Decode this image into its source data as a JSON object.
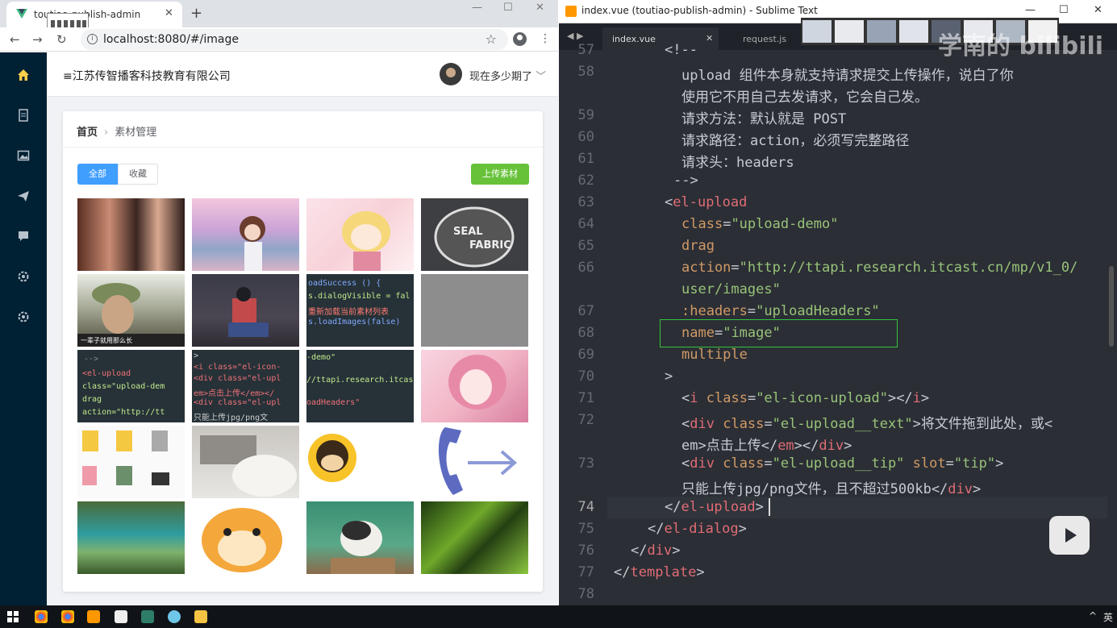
{
  "browser": {
    "tab_title": "toutiao-publish-admin",
    "url": "localhost:8080/#/image",
    "new_tab": "+",
    "tab_close": "✕"
  },
  "app": {
    "company": "≡江苏传智播客科技教育有限公司",
    "user_name": "现在多少期了",
    "breadcrumb": {
      "home": "首页",
      "current": "素材管理"
    },
    "filters": [
      "全部",
      "收藏"
    ],
    "upload_label": "上传素材",
    "code_thumbs": {
      "t7": [
        "oadSuccess () {",
        "s.dialogVisible = fal",
        "重新加载当前素材列表",
        "s.loadImages(false)"
      ],
      "t9": [
        "-->",
        "<el-upload",
        "  class=\"upload-dem",
        "  drag",
        "  action=\"http://tt"
      ],
      "t10": [
        ">",
        "  <i class=\"el-icon-",
        "  <div class=\"el-upl",
        "  em>点击上传</em></",
        "  <div class=\"el-upl",
        "  只能上传jpg/png文"
      ],
      "t11": [
        "-demo\"",
        "//ttapi.research.itcast",
        "oadHeaders\""
      ]
    },
    "meme_caption": "一辈子就用那么长"
  },
  "sublime": {
    "title": "index.vue (toutiao-publish-admin) - Sublime Text",
    "tabs": [
      "index.vue",
      "request.js"
    ],
    "watermark": "学南的 bilibili",
    "line_numbers": [
      "57",
      "58",
      "",
      "59",
      "60",
      "61",
      "62",
      "63",
      "64",
      "65",
      "66",
      "",
      "67",
      "68",
      "69",
      "70",
      "71",
      "72",
      "",
      "73",
      "",
      "74",
      "75",
      "76",
      "77",
      "78"
    ],
    "code": {
      "l57": "<!--",
      "l58a": "upload 组件本身就支持请求提交上传操作，说白了你",
      "l58b": "使用它不用自己去发请求，它会自己发。",
      "l59": "请求方法：默认就是 POST",
      "l60": "请求路径：action，必须写完整路径",
      "l61": "请求头：headers",
      "l62": "-->",
      "l63": "el-upload",
      "l64_attr": "class",
      "l64_val": "\"upload-demo\"",
      "l65": "drag",
      "l66_attr": "action",
      "l66_val": "\"http://ttapi.research.itcast.cn/mp/v1_0/",
      "l66_val2": "user/images\"",
      "l67_attr": ":headers",
      "l67_val": "\"uploadHeaders\"",
      "l68_attr": "name",
      "l68_val": "\"image\"",
      "l69": "multiple",
      "l70": ">",
      "l71_tag": "i",
      "l71_attr": "class",
      "l71_val": "\"el-icon-upload\"",
      "l71_close": "i",
      "l72_tag": "div",
      "l72_attr": "class",
      "l72_val": "\"el-upload__text\"",
      "l72_text": "将文件拖到此处，或<",
      "l72b_text1": "em>点击上传</",
      "l72b_tag": "em",
      "l72b_close": "div",
      "l73_tag": "div",
      "l73_attr1": "class",
      "l73_val1": "\"el-upload__tip\"",
      "l73_attr2": "slot",
      "l73_val2": "\"tip\"",
      "l73b_text": "只能上传jpg/png文件，且不超过500kb</",
      "l73b_close": "div",
      "l74": "el-upload",
      "l75": "el-dialog",
      "l76": "div",
      "l77": "template"
    }
  },
  "taskbar": {
    "ime": "英"
  }
}
